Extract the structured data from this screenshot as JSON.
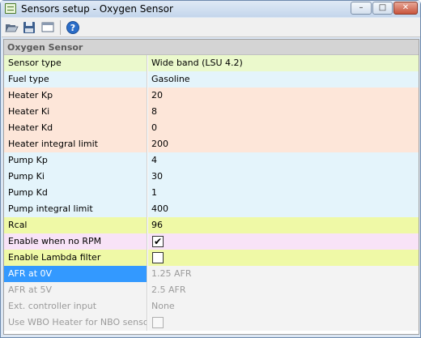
{
  "window": {
    "title": "Sensors setup - Oxygen Sensor",
    "minimize_glyph": "–",
    "maximize_glyph": "□",
    "close_glyph": "✕"
  },
  "toolbar": {
    "icons": [
      "open-folder-icon",
      "save-icon",
      "view-icon",
      "help-icon"
    ]
  },
  "section": {
    "title": "Oxygen Sensor"
  },
  "rows": [
    {
      "label": "Sensor type",
      "value": "Wide band (LSU 4.2)"
    },
    {
      "label": "Fuel type",
      "value": "Gasoline"
    },
    {
      "label": "Heater Kp",
      "value": "20"
    },
    {
      "label": "Heater Ki",
      "value": "8"
    },
    {
      "label": "Heater Kd",
      "value": "0"
    },
    {
      "label": "Heater integral limit",
      "value": "200"
    },
    {
      "label": "Pump Kp",
      "value": "4"
    },
    {
      "label": "Pump Ki",
      "value": "30"
    },
    {
      "label": "Pump Kd",
      "value": "1"
    },
    {
      "label": "Pump integral limit",
      "value": "400"
    },
    {
      "label": "Rcal",
      "value": "96"
    },
    {
      "label": "Enable when no RPM",
      "checked": true,
      "mark": "✔"
    },
    {
      "label": "Enable Lambda filter",
      "checked": false
    },
    {
      "label": "AFR at 0V",
      "value": "1.25 AFR"
    },
    {
      "label": "AFR at 5V",
      "value": "2.5 AFR"
    },
    {
      "label": "Ext. controller input",
      "value": "None"
    },
    {
      "label": "Use WBO Heater for NBO sensor",
      "checked": false
    }
  ],
  "colors": {
    "sensor_fuel": "#ebf9cc",
    "fuel": "#e4f4fb",
    "heater": "#fde6d9",
    "pump": "#e4f4fb",
    "rcal": "#eff9a6",
    "enable_rpm": "#f8e3f7",
    "disabled": "#f3f3f3",
    "selected": "#3399ff"
  }
}
